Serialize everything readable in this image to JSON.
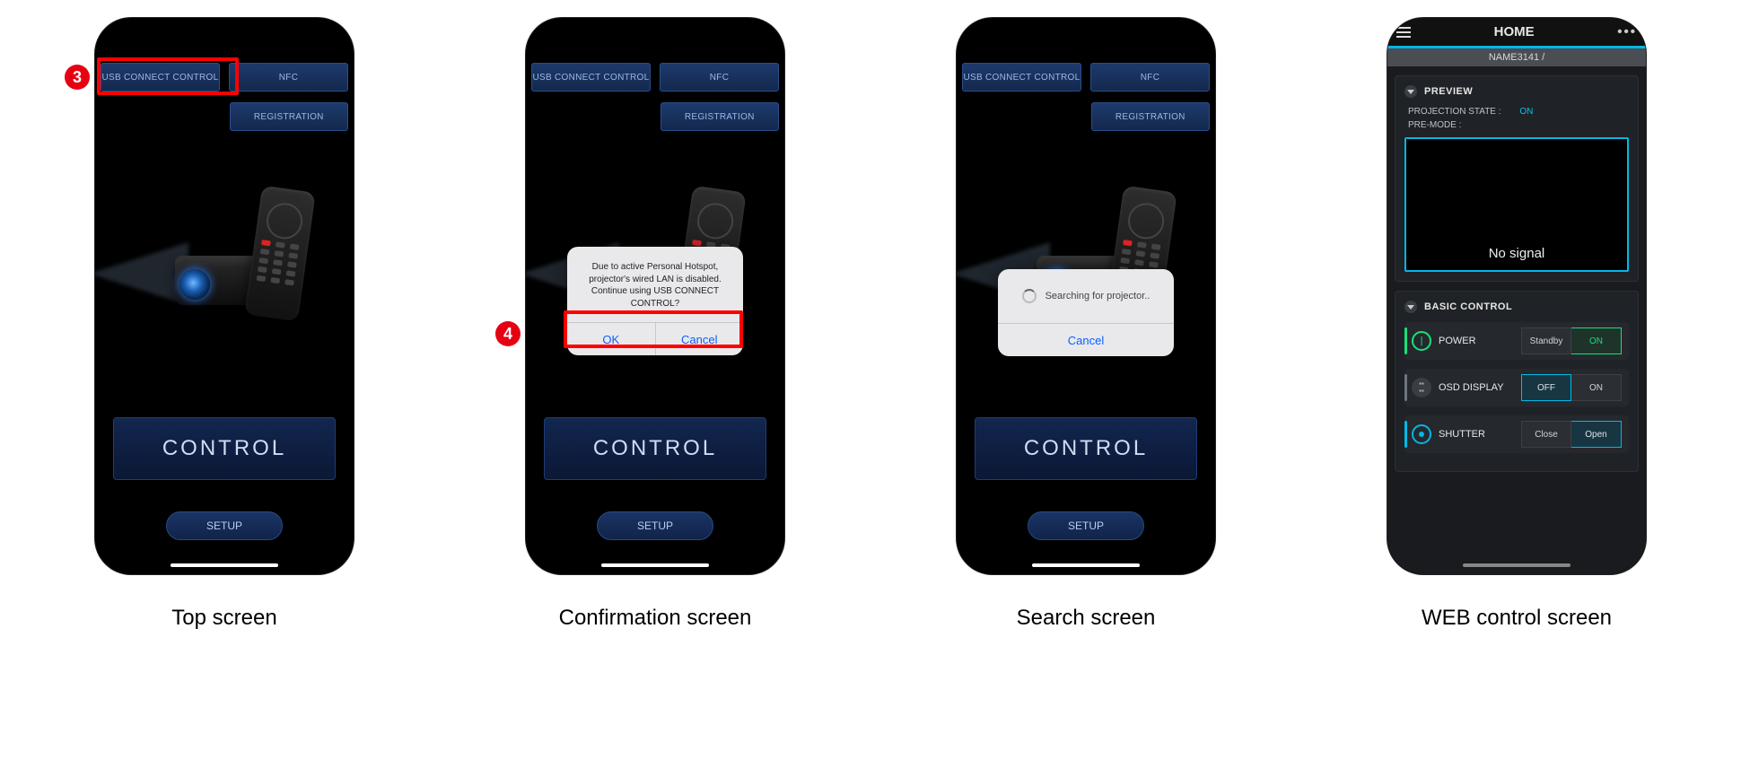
{
  "badges": {
    "three": "3",
    "four": "4"
  },
  "captions": {
    "top": "Top screen",
    "confirmation": "Confirmation screen",
    "search": "Search screen",
    "web": "WEB control screen"
  },
  "nav": {
    "usb": "USB CONNECT CONTROL",
    "nfc": "NFC",
    "registration": "REGISTRATION"
  },
  "main": {
    "control": "CONTROL",
    "setup": "SETUP"
  },
  "confirm_dialog": {
    "message": "Due to active Personal Hotspot, projector's wired LAN is disabled. Continue using USB CONNECT CONTROL?",
    "ok": "OK",
    "cancel": "Cancel"
  },
  "search_dialog": {
    "message": "Searching for projector..",
    "cancel": "Cancel"
  },
  "web": {
    "title": "HOME",
    "device_name": "NAME3141 /",
    "preview": {
      "title": "PREVIEW",
      "proj_state_label": "PROJECTION STATE :",
      "proj_state_value": "ON",
      "pre_mode_label": "PRE-MODE :",
      "no_signal": "No signal"
    },
    "basic": {
      "title": "BASIC CONTROL",
      "power": {
        "label": "POWER",
        "left": "Standby",
        "right": "ON"
      },
      "osd": {
        "label": "OSD DISPLAY",
        "left": "OFF",
        "right": "ON"
      },
      "shutter": {
        "label": "SHUTTER",
        "left": "Close",
        "right": "Open"
      }
    }
  }
}
